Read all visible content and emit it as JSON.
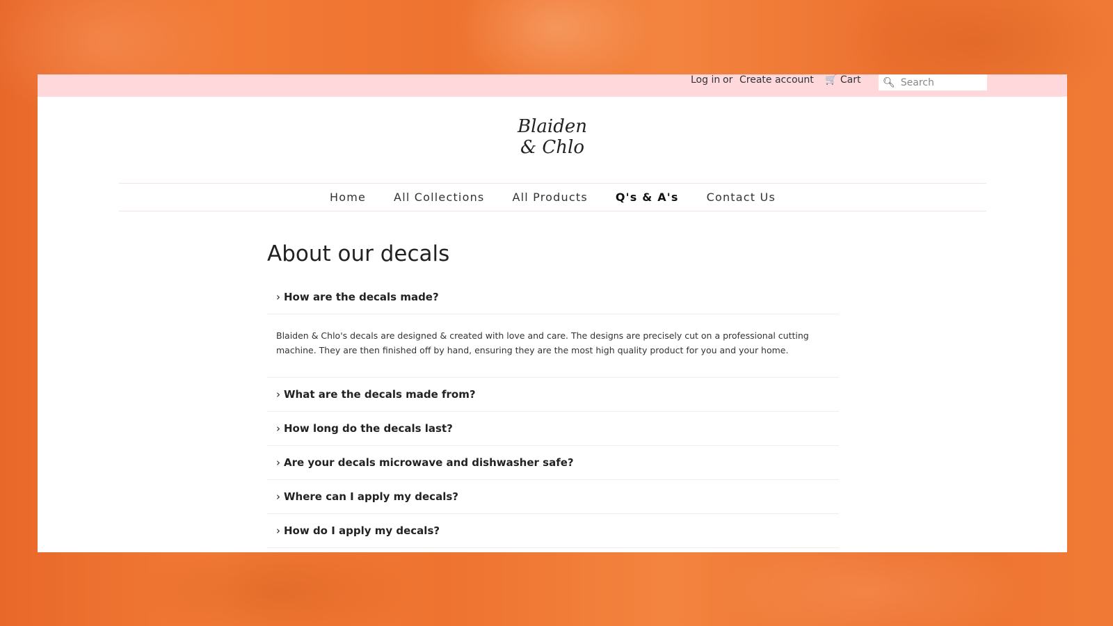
{
  "header": {
    "login": "Log in",
    "or": "or",
    "create_account": "Create account",
    "cart": "Cart",
    "search_placeholder": "Search"
  },
  "logo": {
    "line1": "Blaiden",
    "line2": "& Chlo"
  },
  "nav": {
    "items": [
      "Home",
      "All Collections",
      "All Products",
      "Q's & A's",
      "Contact Us"
    ],
    "active": "Q's & A's"
  },
  "page": {
    "title": "About our decals",
    "faq": [
      {
        "q": "How are the decals made?",
        "a": "Blaiden & Chlo's decals are designed & created with love and care. The designs are precisely cut on a professional cutting machine. They are then finished off by hand, ensuring they are the most high quality product for you and your home."
      },
      {
        "q": "What are the decals made from?"
      },
      {
        "q": "How long do the decals last?"
      },
      {
        "q": "Are your decals microwave and dishwasher safe?"
      },
      {
        "q": "Where can I apply my decals?"
      },
      {
        "q": "How do I apply my decals?"
      }
    ]
  },
  "colors": {
    "topbar": "#ffd8dc",
    "background": "#f07a35"
  }
}
